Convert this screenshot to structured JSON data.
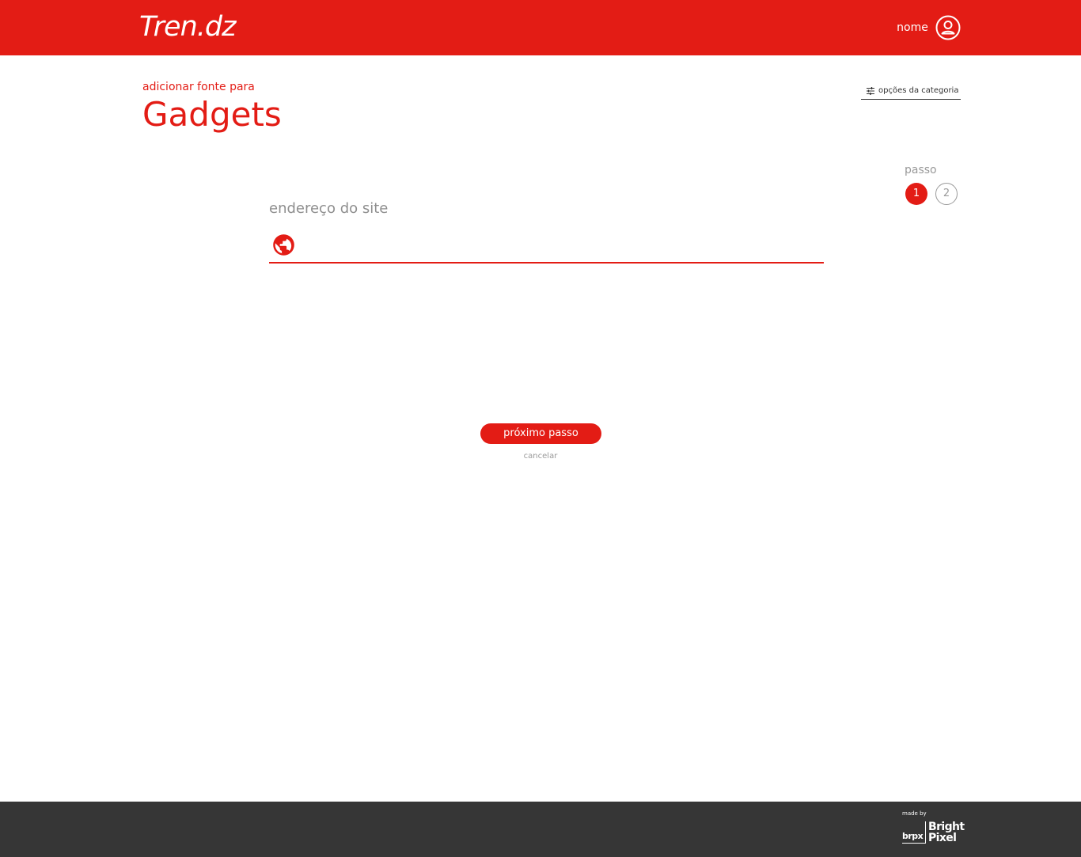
{
  "header": {
    "logo": "Tren.dz",
    "user_name": "nome",
    "avatar_icon": "user-circle-icon"
  },
  "title_section": {
    "subtitle": "adicionar fonte para",
    "title": "Gadgets",
    "category_options_label": "opções da categoria",
    "category_options_icon": "sliders-icon"
  },
  "steps": {
    "label": "passo",
    "items": [
      "1",
      "2"
    ],
    "current": "1"
  },
  "form": {
    "field_label": "endereço do site",
    "field_icon": "globe-icon",
    "field_value": "",
    "field_placeholder": ""
  },
  "actions": {
    "next_label": "próximo passo",
    "cancel_label": "cancelar"
  },
  "footer": {
    "made_by": "made by",
    "brand_short": "brpx",
    "brand_line1": "Bright",
    "brand_line2": "Pixel"
  },
  "colors": {
    "accent": "#e31c15",
    "footer_bg": "#363636",
    "muted_text": "#8f8f8f"
  }
}
